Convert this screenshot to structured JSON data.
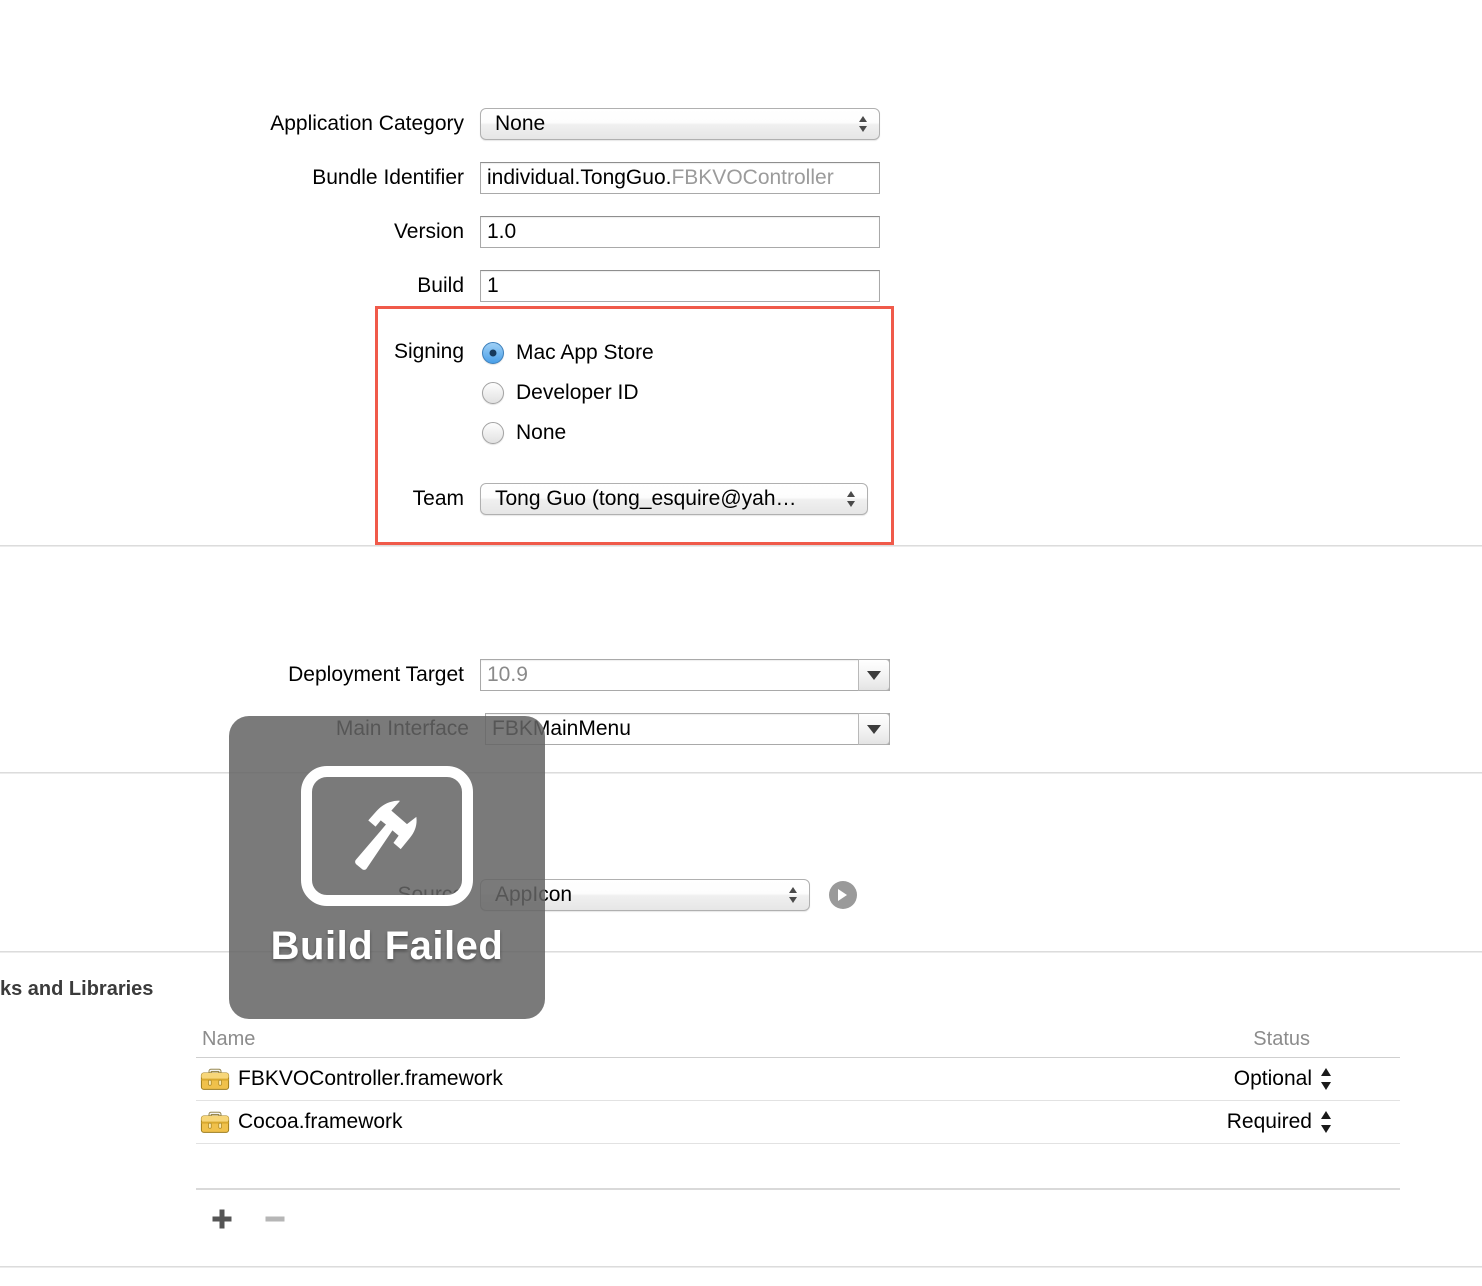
{
  "form": {
    "application_category": {
      "label": "Application Category",
      "value": "None",
      "icon": "updown-stepper-icon"
    },
    "bundle_identifier": {
      "label": "Bundle Identifier",
      "value_typed": "individual.TongGuo.",
      "value_ghost": "FBKVOController"
    },
    "version": {
      "label": "Version",
      "value": "1.0"
    },
    "build": {
      "label": "Build",
      "value": "1"
    },
    "signing": {
      "label": "Signing",
      "options": [
        {
          "label": "Mac App Store",
          "selected": true
        },
        {
          "label": "Developer ID",
          "selected": false
        },
        {
          "label": "None",
          "selected": false
        }
      ],
      "highlight_color": "#f05a4a"
    },
    "team": {
      "label": "Team",
      "value": "Tong Guo (tong_esquire@yah…"
    },
    "deployment_target": {
      "label": "Deployment Target",
      "value": "10.9"
    },
    "main_interface": {
      "label": "Main Interface",
      "value": "FBKMainMenu"
    },
    "app_icon": {
      "label": "Source",
      "value": "AppIcon",
      "reveal_icon": "circle-arrow-right-icon"
    }
  },
  "frameworks_section": {
    "heading": "ks and Libraries",
    "columns": {
      "name": "Name",
      "status": "Status"
    },
    "rows": [
      {
        "icon": "toolbox-icon",
        "name": "FBKVOController.framework",
        "status": "Optional"
      },
      {
        "icon": "toolbox-icon",
        "name": "Cocoa.framework",
        "status": "Required"
      }
    ],
    "add_button": "+",
    "remove_button": "−"
  },
  "build_hud": {
    "icon": "hammer-icon",
    "message": "Build Failed",
    "background_color": "#646464"
  }
}
